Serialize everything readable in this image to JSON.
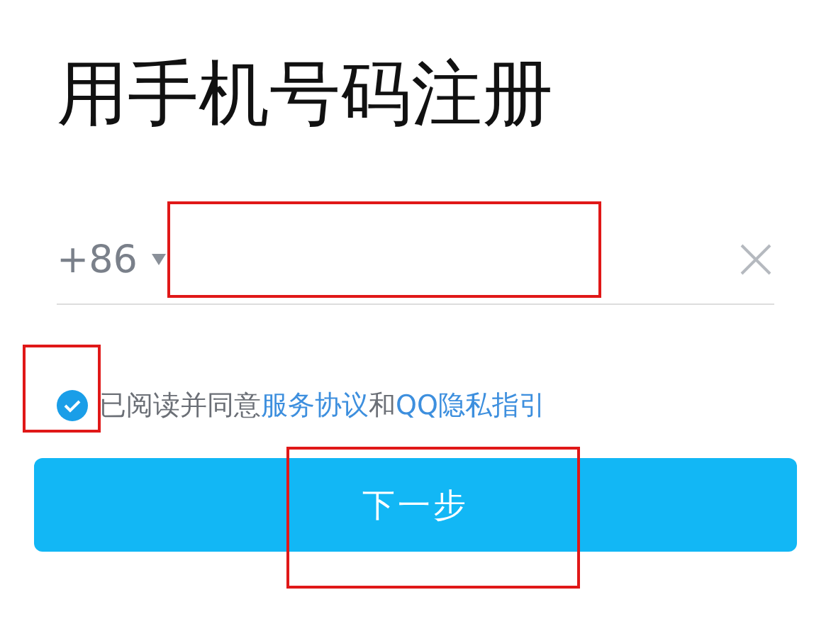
{
  "title": "用手机号码注册",
  "phone": {
    "country_code": "+86",
    "highlighted": true
  },
  "agreement": {
    "checked": true,
    "highlighted": true,
    "parts": [
      {
        "text": "已阅读并同意",
        "link": false
      },
      {
        "text": "服务协议",
        "link": true
      },
      {
        "text": "和",
        "link": false
      },
      {
        "text": "QQ隐私指引",
        "link": true
      }
    ]
  },
  "next_button": {
    "label": "下一步",
    "highlighted": true
  }
}
